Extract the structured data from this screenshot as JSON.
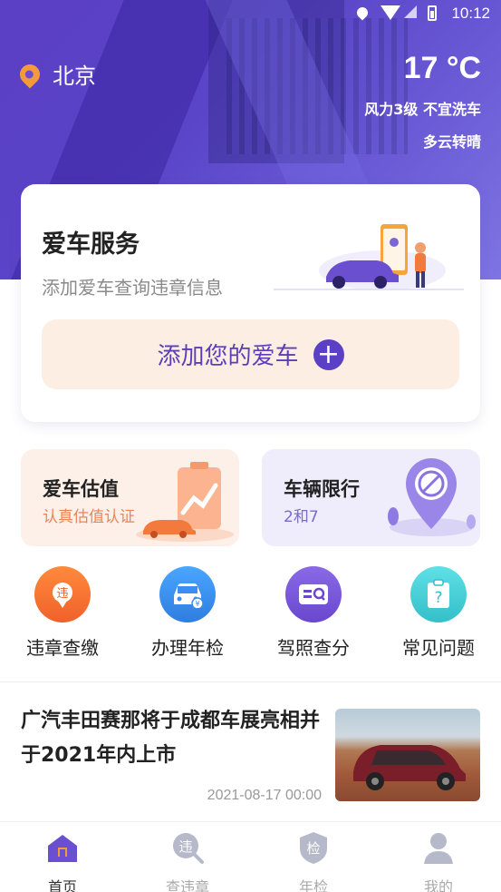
{
  "status_bar": {
    "time": "10:12"
  },
  "location": {
    "city": "北京"
  },
  "weather": {
    "temperature": "17 °C",
    "wind_wash": "风力3级  不宜洗车",
    "condition": "多云转晴"
  },
  "service_card": {
    "title": "爱车服务",
    "subtitle": "添加爱车查询违章信息",
    "add_button": "添加您的爱车"
  },
  "features": [
    {
      "title": "爱车估值",
      "subtitle": "认真估值认证"
    },
    {
      "title": "车辆限行",
      "subtitle": "2和7"
    }
  ],
  "quick_actions": [
    {
      "label": "违章查缴",
      "icon": "violation-icon"
    },
    {
      "label": "办理年检",
      "icon": "car-inspection-icon"
    },
    {
      "label": "驾照查分",
      "icon": "license-icon"
    },
    {
      "label": "常见问题",
      "icon": "faq-icon"
    }
  ],
  "news": {
    "title": "广汽丰田赛那将于成都车展亮相并于2021年内上市",
    "date": "2021-08-17 00:00"
  },
  "tabs": [
    {
      "label": "首页",
      "icon": "home-icon",
      "active": true
    },
    {
      "label": "查违章",
      "icon": "violation-search-icon",
      "active": false
    },
    {
      "label": "年检",
      "icon": "inspection-shield-icon",
      "active": false
    },
    {
      "label": "我的",
      "icon": "profile-icon",
      "active": false
    }
  ],
  "colors": {
    "primary": "#5b3fc4",
    "accent_orange": "#f39a3a",
    "card_peach": "#fdeee3"
  }
}
